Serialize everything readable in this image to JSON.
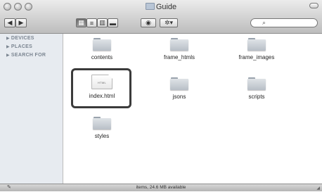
{
  "window": {
    "title": "Guide"
  },
  "toolbar": {
    "back_icon": "◀",
    "forward_icon": "▶",
    "view_icon_glyph": "▦",
    "view_list_glyph": "≡",
    "view_columns_glyph": "▥",
    "view_coverflow_glyph": "▬",
    "quicklook_glyph": "◉",
    "action_glyph": "✲▾",
    "search_glyph": "⌕",
    "search_value": ""
  },
  "sidebar": {
    "items": [
      {
        "label": "DEVICES"
      },
      {
        "label": "PLACES"
      },
      {
        "label": "SEARCH FOR"
      }
    ]
  },
  "files": {
    "items": [
      {
        "name": "contents",
        "kind": "folder"
      },
      {
        "name": "frame_htmls",
        "kind": "folder"
      },
      {
        "name": "frame_images",
        "kind": "folder"
      },
      {
        "name": "index.html",
        "kind": "html-document",
        "ext_label": "HTML"
      },
      {
        "name": "jsons",
        "kind": "folder"
      },
      {
        "name": "scripts",
        "kind": "folder"
      },
      {
        "name": "styles",
        "kind": "folder"
      }
    ]
  },
  "statusbar": {
    "text": "items, 24.6 MB available",
    "icon": "✎"
  },
  "colors": {
    "selection_border": "#3b3b3b",
    "sidebar_bg": "#e7ebf0",
    "sidebar_text": "#7b8591"
  }
}
